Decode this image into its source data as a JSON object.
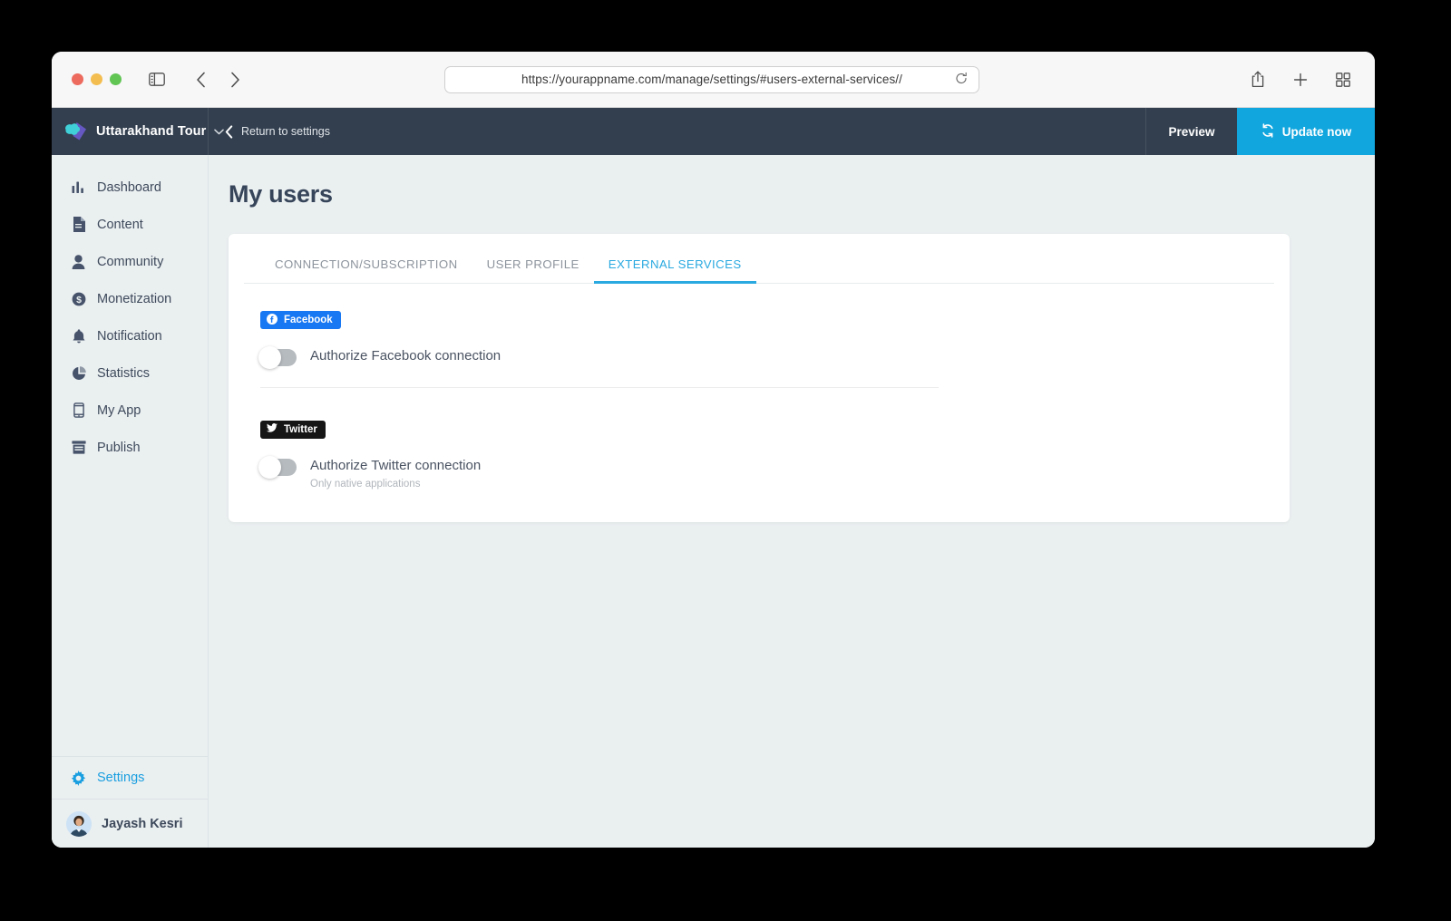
{
  "browser": {
    "url": "https://yourappname.com/manage/settings/#users-external-services//",
    "icons": {
      "sidebar_toggle": "sidebar-toggle-icon",
      "back": "back-chevron-icon",
      "forward": "forward-chevron-icon",
      "reload": "reload-icon",
      "share": "share-icon",
      "new_tab": "plus-icon",
      "tab_overview": "tab-overview-icon"
    }
  },
  "appbar": {
    "brand_name": "Uttarakhand Tour",
    "return_label": "Return to settings",
    "preview_label": "Preview",
    "update_label": "Update now"
  },
  "sidebar": {
    "items": [
      {
        "label": "Dashboard",
        "icon": "bar-chart-icon"
      },
      {
        "label": "Content",
        "icon": "document-icon"
      },
      {
        "label": "Community",
        "icon": "person-icon"
      },
      {
        "label": "Monetization",
        "icon": "dollar-circle-icon"
      },
      {
        "label": "Notification",
        "icon": "bell-icon"
      },
      {
        "label": "Statistics",
        "icon": "pie-chart-icon"
      },
      {
        "label": "My App",
        "icon": "phone-icon"
      },
      {
        "label": "Publish",
        "icon": "store-icon"
      }
    ],
    "settings_label": "Settings",
    "user_name": "Jayash Kesri"
  },
  "main": {
    "page_title": "My users",
    "tabs": [
      {
        "label": "CONNECTION/SUBSCRIPTION",
        "active": false
      },
      {
        "label": "USER PROFILE",
        "active": false
      },
      {
        "label": "EXTERNAL SERVICES",
        "active": true
      }
    ],
    "services": [
      {
        "badge_label": "Facebook",
        "badge_icon": "facebook-icon",
        "toggle_label": "Authorize Facebook connection",
        "toggle_state": "off",
        "sub_label": ""
      },
      {
        "badge_label": "Twitter",
        "badge_icon": "twitter-icon",
        "toggle_label": "Authorize Twitter connection",
        "toggle_state": "off",
        "sub_label": "Only native applications"
      }
    ]
  },
  "colors": {
    "accent_blue": "#29a9e0",
    "appbar_dark": "#333f4f",
    "update_blue": "#12a6de",
    "page_bg": "#eaeff0",
    "facebook_blue": "#1877f2",
    "twitter_black": "#161616"
  }
}
